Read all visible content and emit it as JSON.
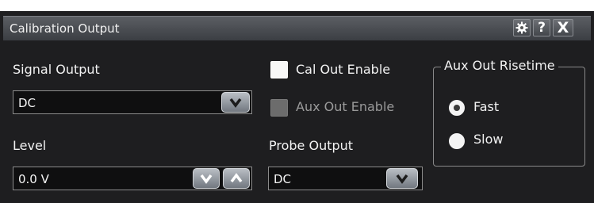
{
  "dialog": {
    "title": "Calibration Output",
    "buttons": {
      "settings_icon": "gear-icon",
      "help_label": "?",
      "close_label": "X"
    }
  },
  "signal_output": {
    "label": "Signal Output",
    "value": "DC"
  },
  "level": {
    "label": "Level",
    "value": "0.0 V"
  },
  "cal_out_enable": {
    "label": "Cal Out Enable",
    "checked": false
  },
  "aux_out_enable": {
    "label": "Aux Out Enable",
    "checked": false,
    "enabled": false
  },
  "probe_output": {
    "label": "Probe Output",
    "value": "DC"
  },
  "aux_out_risetime": {
    "label": "Aux Out Risetime",
    "options": [
      {
        "label": "Fast",
        "selected": true
      },
      {
        "label": "Slow",
        "selected": false
      }
    ]
  },
  "colors": {
    "dialog_background": "#1e1e20",
    "titlebar": "#4a4d52",
    "field_background": "#0f0f10",
    "button_silver": "#9da2a8"
  }
}
